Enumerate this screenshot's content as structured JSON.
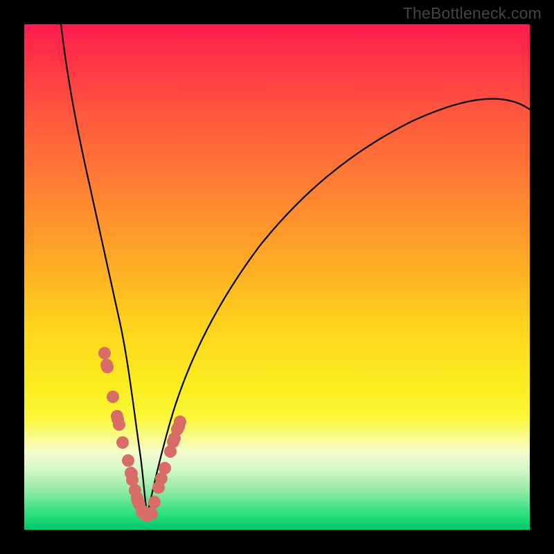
{
  "watermark": "TheBottleneck.com",
  "colors": {
    "frame": "#000000",
    "curve": "#000000",
    "dot": "#d86d68",
    "gradient_top": "#ff1a50",
    "gradient_bottom": "#00c86b"
  },
  "chart_data": {
    "type": "line",
    "title": "",
    "xlabel": "",
    "ylabel": "",
    "xlim": [
      0,
      100
    ],
    "ylim": [
      0,
      100
    ],
    "note": "Axes unlabeled in source image; values are estimated relative 0–100 coordinates from pixel positions within the 730×730 plot area.",
    "series": [
      {
        "name": "left-branch",
        "x": [
          7.3,
          8.2,
          9.6,
          11.4,
          13.0,
          14.4,
          15.6,
          16.6,
          17.7,
          18.6,
          19.6,
          20.5,
          21.4,
          22.2,
          23.0
        ],
        "y": [
          100.0,
          89.0,
          76.7,
          63.0,
          52.1,
          43.8,
          37.0,
          31.5,
          26.4,
          22.2,
          17.8,
          14.0,
          10.3,
          7.1,
          4.4
        ]
      },
      {
        "name": "right-branch",
        "x": [
          25.2,
          26.6,
          28.1,
          29.6,
          31.5,
          33.6,
          36.3,
          39.7,
          44.5,
          50.7,
          58.9,
          68.5,
          80.8,
          95.9,
          100.0
        ],
        "y": [
          4.2,
          8.5,
          13.2,
          17.8,
          23.3,
          28.8,
          34.9,
          41.4,
          48.6,
          55.8,
          63.0,
          69.6,
          75.8,
          81.6,
          83.2
        ]
      },
      {
        "name": "dots-left",
        "x": [
          15.9,
          16.3,
          16.4,
          17.5,
          18.4,
          18.5,
          18.8,
          19.5,
          20.5,
          21.1,
          21.2,
          21.4,
          21.9,
          22.3,
          22.5,
          22.7,
          23.4,
          24.1
        ],
        "y": [
          34.9,
          32.6,
          32.2,
          26.3,
          22.5,
          21.9,
          20.8,
          17.3,
          13.7,
          11.2,
          11.1,
          9.9,
          7.8,
          6.3,
          5.6,
          5.1,
          3.7,
          2.9
        ]
      },
      {
        "name": "dots-right",
        "x": [
          25.2,
          25.8,
          26.6,
          27.1,
          27.8,
          28.9,
          29.5,
          29.7,
          30.3,
          30.5,
          30.8
        ],
        "y": [
          3.2,
          5.5,
          8.4,
          10.1,
          12.2,
          15.5,
          17.4,
          18.1,
          19.9,
          20.4,
          21.4
        ]
      },
      {
        "name": "valley-arc",
        "x": [
          23.3,
          23.7,
          24.1,
          24.5,
          25.1
        ],
        "y": [
          3.6,
          2.9,
          2.6,
          2.7,
          3.3
        ]
      }
    ]
  }
}
